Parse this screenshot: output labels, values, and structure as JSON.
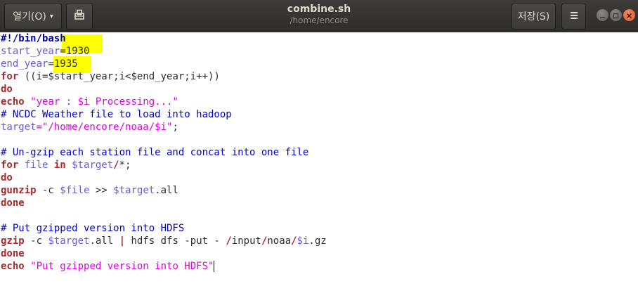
{
  "titlebar": {
    "open_label": "열기(O)",
    "open_caret": "▾",
    "title": "combine.sh",
    "subtitle": "/home/encore",
    "save_label": "저장(S)"
  },
  "icons": {
    "pin": "pin-to-panel-icon",
    "menu": "hamburger-menu-icon",
    "minimize": "minimize-icon",
    "maximize": "maximize-icon",
    "close": "close-icon"
  },
  "colors": {
    "titlebar": "#3c3b37",
    "highlight": "#ffff00",
    "keyword": "#a52a2a",
    "variable": "#6a5acd",
    "string": "#e000e0",
    "comment": "#0000cc"
  },
  "code": {
    "l1": "#!/bin/bash",
    "l2_var": "start_year",
    "l2_rest": "=1930",
    "l3_var": "end_year",
    "l3_rest": "=1935",
    "l4_kw": "for",
    "l4_rest": " ((i=$start_year;i<$end_year;i++))",
    "l5": "do",
    "l6_kw": "echo",
    "l6_str": "\"year : $i Processing...\"",
    "l7": "# NCDC Weather file to load into hadoop",
    "l8_var": "target",
    "l8_str": "=\"/home/encore/noaa/$i\"",
    "l8_end": ";",
    "l10": "# Un-gzip each station file and concat into one file",
    "l11_kw": "for",
    "l11_var": " file ",
    "l11_in": "in",
    "l11_var2": " $target",
    "l11_path": "/",
    "l11_rest": "*;",
    "l12": "do",
    "l13_kw": "gunzip",
    "l13_a": " -c ",
    "l13_var": "$file",
    "l13_b": " >> ",
    "l13_var2": "$target",
    "l13_c": ".all",
    "l14": "done",
    "l16": "# Put gzipped version into HDFS",
    "l17_kw": "gzip",
    "l17_a": " -c ",
    "l17_var": "$target",
    "l17_b": ".all ",
    "l17_pipe": "|",
    "l17_c": " hdfs dfs -put - ",
    "l17_p1": "/",
    "l17_d": "input",
    "l17_p2": "/",
    "l17_e": "noaa",
    "l17_p3": "/",
    "l17_var2": "$i",
    "l17_f": ".gz",
    "l18": "done",
    "l19_kw": "echo",
    "l19_str": "\"Put gzipped version into HDFS\""
  }
}
